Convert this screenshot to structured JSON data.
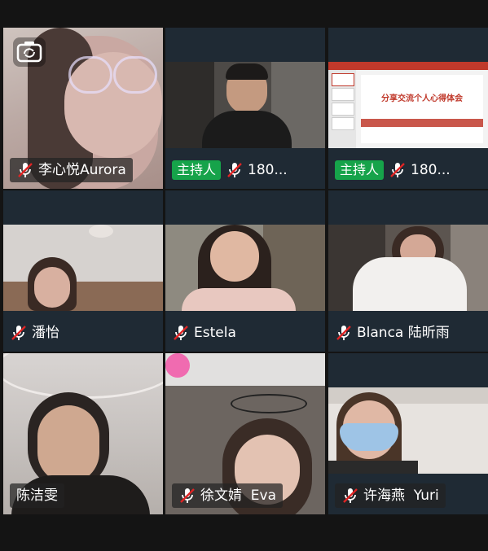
{
  "participants": [
    {
      "name": "李心悦Aurora",
      "muted": true,
      "host": false
    },
    {
      "name": "180...",
      "muted": true,
      "host": true
    },
    {
      "name": "180...",
      "muted": true,
      "host": true
    },
    {
      "name": "潘怡",
      "muted": true,
      "host": false
    },
    {
      "name": "Estela",
      "muted": true,
      "host": false
    },
    {
      "name": "Blanca 陆昕雨",
      "muted": true,
      "host": false
    },
    {
      "name": "陈洁雯",
      "muted": false,
      "host": false
    },
    {
      "name": "徐文婧  Eva",
      "muted": true,
      "host": false
    },
    {
      "name": "许海燕  Yuri",
      "muted": true,
      "host": false
    }
  ],
  "host_badge": "主持人",
  "shared_slide": {
    "title": "分享交流个人心得体会"
  },
  "icons": {
    "muted": "mic-off-icon",
    "camera_switch": "camera-switch-icon"
  },
  "colors": {
    "background": "#141414",
    "tile_bg": "#1f2a34",
    "host_badge": "#16a34a",
    "mute_red": "#e02424"
  }
}
